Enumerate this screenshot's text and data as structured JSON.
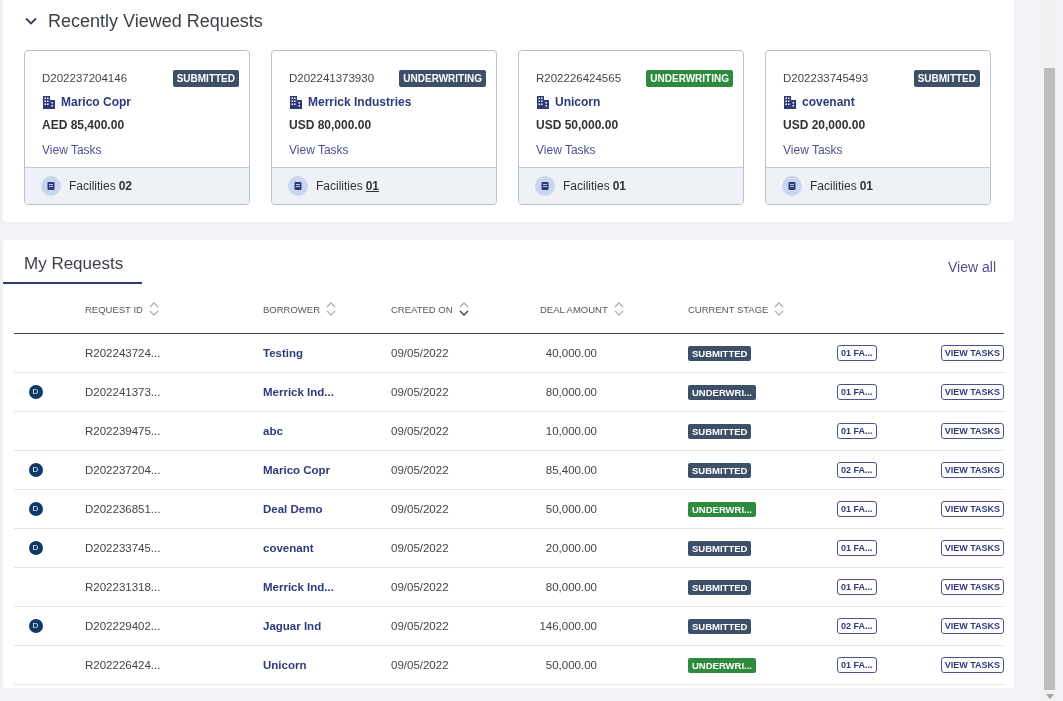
{
  "recent": {
    "title": "Recently Viewed Requests",
    "expanded": true,
    "cards": [
      {
        "request_id": "D202237204146",
        "stage": "SUBMITTED",
        "color": "#3d5068",
        "borrower": "Marico Copr",
        "amount": "AED 85,400.00",
        "link": "View Tasks",
        "facilities_label": "Facilities",
        "facilities_count": "02",
        "count_underlined": false
      },
      {
        "request_id": "D202241373930",
        "stage": "UNDERWRITING",
        "color": "#3d5068",
        "borrower": "Merrick Industries",
        "amount": "USD 80,000.00",
        "link": "View Tasks",
        "facilities_label": "Facilities",
        "facilities_count": "01",
        "count_underlined": true
      },
      {
        "request_id": "R202226424565",
        "stage": "UNDERWRITING",
        "color": "#2e8b3e",
        "borrower": "Unicorn",
        "amount": "USD 50,000.00",
        "link": "View Tasks",
        "facilities_label": "Facilities",
        "facilities_count": "01",
        "count_underlined": false
      },
      {
        "request_id": "D202233745493",
        "stage": "SUBMITTED",
        "color": "#3d5068",
        "borrower": "covenant",
        "amount": "USD 20,000.00",
        "link": "View Tasks",
        "facilities_label": "Facilities",
        "facilities_count": "01",
        "count_underlined": false
      }
    ]
  },
  "requests": {
    "tabs": [
      {
        "label": "My Requests",
        "selected": true
      }
    ],
    "view_all": "View all",
    "table": {
      "columns": [
        {
          "label": "REQUEST ID",
          "sorted": false
        },
        {
          "label": "BORROWER",
          "sorted": false
        },
        {
          "label": "CREATED ON",
          "sorted": true
        },
        {
          "label": "DEAL AMOUNT",
          "sorted": false
        },
        {
          "label": "CURRENT STAGE",
          "sorted": false
        }
      ],
      "rows": [
        {
          "request_id": "R202243724...",
          "borrower": "Testing",
          "created_on": "09/05/2022",
          "deal_amount": "40,000.00",
          "stage": "SUBMITTED",
          "color": "#3d5068",
          "facilities": "01 FA...",
          "action": "VIEW TASKS"
        },
        {
          "marker": "D",
          "request_id": "D202241373...",
          "borrower": "Merrick Ind...",
          "created_on": "09/05/2022",
          "deal_amount": "80,000.00",
          "stage": "UNDERWRI...",
          "color": "#3d5068",
          "facilities": "01 FA...",
          "action": "VIEW TASKS"
        },
        {
          "request_id": "R202239475...",
          "borrower": "abc",
          "created_on": "09/05/2022",
          "deal_amount": "10,000.00",
          "stage": "SUBMITTED",
          "color": "#3d5068",
          "facilities": "01 FA...",
          "action": "VIEW TASKS"
        },
        {
          "marker": "D",
          "request_id": "D202237204...",
          "borrower": "Marico Copr",
          "created_on": "09/05/2022",
          "deal_amount": "85,400.00",
          "stage": "SUBMITTED",
          "color": "#3d5068",
          "facilities": "02 FA...",
          "action": "VIEW TASKS"
        },
        {
          "marker": "D",
          "request_id": "D202236851...",
          "borrower": "Deal Demo",
          "created_on": "09/05/2022",
          "deal_amount": "50,000.00",
          "stage": "UNDERWRI...",
          "color": "#2e8b3e",
          "facilities": "01 FA...",
          "action": "VIEW TASKS"
        },
        {
          "marker": "D",
          "request_id": "D202233745...",
          "borrower": "covenant",
          "created_on": "09/05/2022",
          "deal_amount": "20,000.00",
          "stage": "SUBMITTED",
          "color": "#3d5068",
          "facilities": "01 FA...",
          "action": "VIEW TASKS"
        },
        {
          "request_id": "R202231318...",
          "borrower": "Merrick Ind...",
          "created_on": "09/05/2022",
          "deal_amount": "80,000.00",
          "stage": "SUBMITTED",
          "color": "#3d5068",
          "facilities": "01 FA...",
          "action": "VIEW TASKS"
        },
        {
          "marker": "D",
          "request_id": "D202229402...",
          "borrower": "Jaguar Ind",
          "created_on": "09/05/2022",
          "deal_amount": "146,000.00",
          "stage": "SUBMITTED",
          "color": "#3d5068",
          "facilities": "02 FA...",
          "action": "VIEW TASKS"
        },
        {
          "request_id": "R202226424...",
          "borrower": "Unicorn",
          "created_on": "09/05/2022",
          "deal_amount": "50,000.00",
          "stage": "UNDERWRI...",
          "color": "#2e8b3e",
          "facilities": "01 FA...",
          "action": "VIEW TASKS"
        }
      ]
    }
  }
}
